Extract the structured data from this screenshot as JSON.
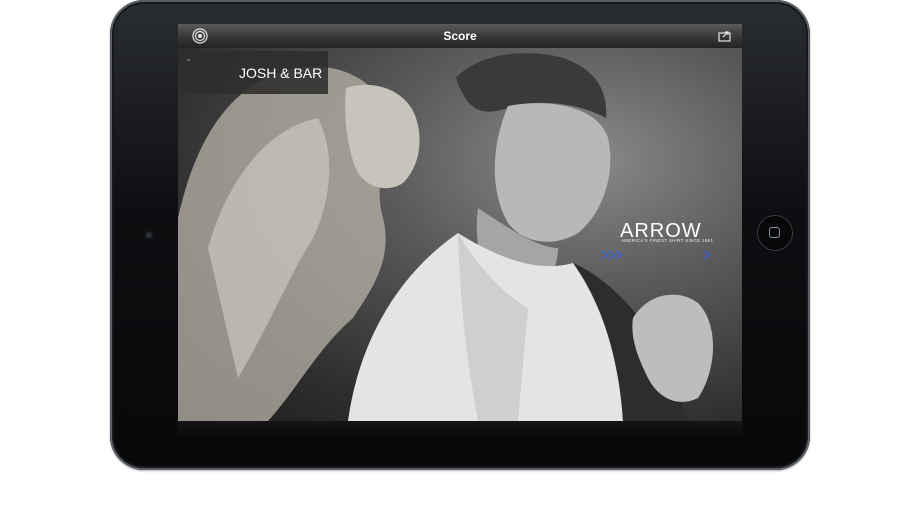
{
  "app": {
    "title": "Score"
  },
  "overlay": {
    "dash": "-",
    "name": "JOSH & BAR"
  },
  "ad": {
    "brand": "ARROW",
    "tagline": "AMERICA'S FINEST SHIRT SINCE 1851"
  },
  "icons": {
    "left": "target-icon",
    "right": "share-icon",
    "home": "home-button-icon"
  },
  "colors": {
    "brand_accent": "#3a63c7",
    "toolbar_top": "#5b5b5b",
    "toolbar_bottom": "#222222"
  }
}
